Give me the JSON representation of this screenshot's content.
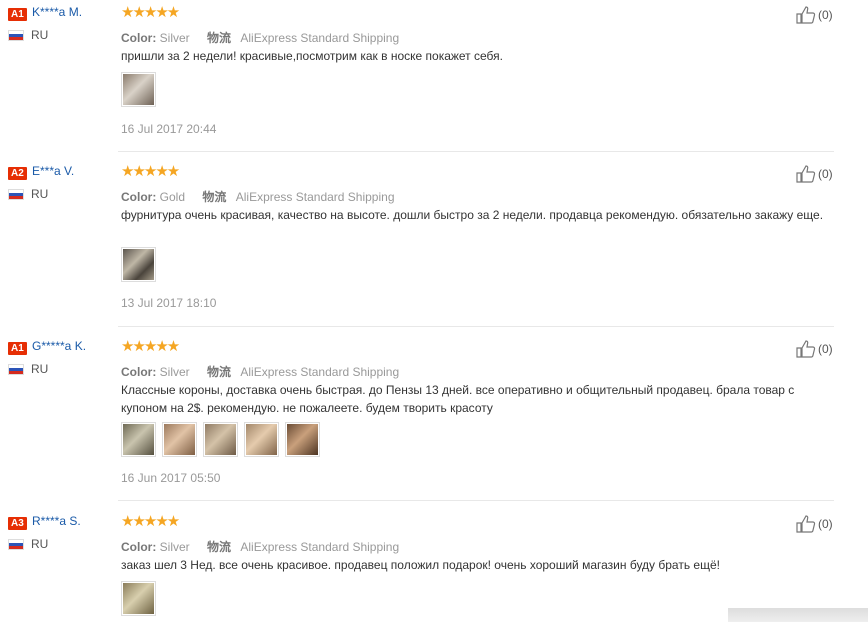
{
  "reviews": [
    {
      "level": "A1",
      "name": "K****a M.",
      "country": "RU",
      "stars": "★★★★★",
      "color_label": "Color:",
      "color": "Silver",
      "logistics": "物流",
      "shipping": "AliExpress Standard Shipping",
      "text": "пришли за 2 недели! красивые,посмотрим как в носке покажет себя.",
      "date": "16 Jul 2017 20:44",
      "helpful": "(0)",
      "photo_count": 1
    },
    {
      "level": "A2",
      "name": "E***a V.",
      "country": "RU",
      "stars": "★★★★★",
      "color_label": "Color:",
      "color": "Gold",
      "logistics": "物流",
      "shipping": "AliExpress Standard Shipping",
      "text": "фурнитура очень красивая, качество на высоте. дошли быстро за 2 недели. продавца рекомендую. обязательно закажу еще.",
      "date": "13 Jul 2017 18:10",
      "helpful": "(0)",
      "photo_count": 1
    },
    {
      "level": "A1",
      "name": "G*****a K.",
      "country": "RU",
      "stars": "★★★★★",
      "color_label": "Color:",
      "color": "Silver",
      "logistics": "物流",
      "shipping": "AliExpress Standard Shipping",
      "text": "Классные короны, доставка очень быстрая. до Пензы 13 дней. все оперативно и общительный продавец. брала товар с купоном на 2$. рекомендую. не пожалеете. будем творить красоту",
      "date": "16 Jun 2017 05:50",
      "helpful": "(0)",
      "photo_count": 5
    },
    {
      "level": "A3",
      "name": "R****a S.",
      "country": "RU",
      "stars": "★★★★★",
      "color_label": "Color:",
      "color": "Silver",
      "logistics": "物流",
      "shipping": "AliExpress Standard Shipping",
      "text": "заказ шел 3 Нед. все очень красивое. продавец положил подарок! очень хороший магазин буду брать ещё!",
      "date": "",
      "helpful": "(0)",
      "photo_count": 1
    }
  ],
  "colors": {
    "level_badge": "#e62e04",
    "name_link": "#1a5aa8",
    "stars": "#f5a623"
  }
}
